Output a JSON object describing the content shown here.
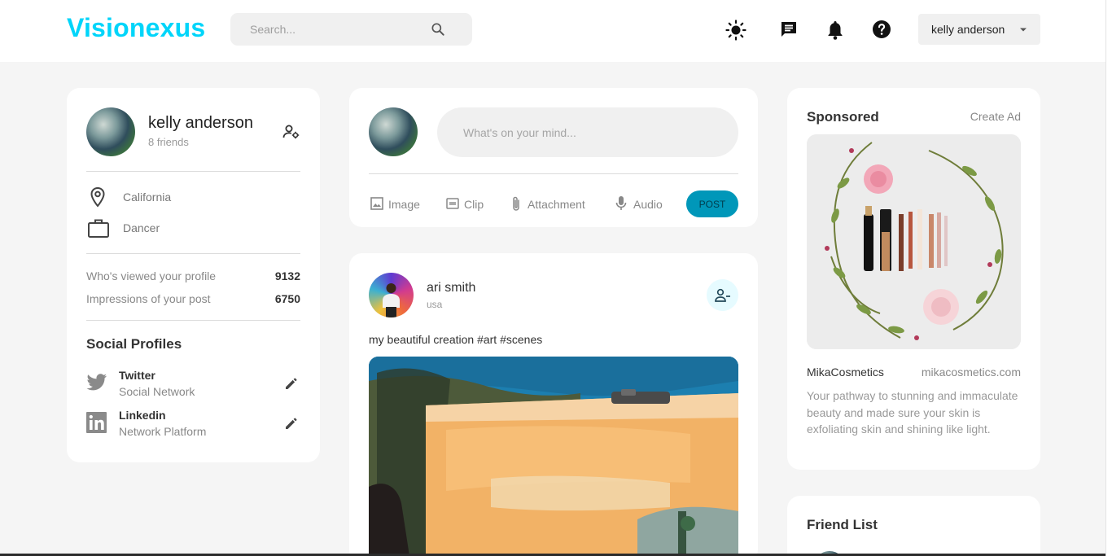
{
  "app": {
    "logo": "Visionexus",
    "search_placeholder": "Search...",
    "user_menu_label": "kelly anderson"
  },
  "icons": {
    "theme": "sun-icon",
    "messages": "chat-icon",
    "notifications": "bell-icon",
    "help": "help-icon",
    "caret": "caret-down-icon"
  },
  "profile": {
    "name": "kelly anderson",
    "friends": "8 friends",
    "location": "California",
    "occupation": "Dancer",
    "stats": [
      {
        "label": "Who's viewed your profile",
        "value": "9132"
      },
      {
        "label": "Impressions of your post",
        "value": "6750"
      }
    ],
    "social_title": "Social Profiles",
    "socials": [
      {
        "name": "Twitter",
        "sub": "Social Network"
      },
      {
        "name": "Linkedin",
        "sub": "Network Platform"
      }
    ]
  },
  "composer": {
    "placeholder": "What's on your mind...",
    "actions": [
      "Image",
      "Clip",
      "Attachment",
      "Audio"
    ],
    "post_label": "POST"
  },
  "post": {
    "author": "ari smith",
    "location": "usa",
    "text": "my beautiful creation #art #scenes"
  },
  "sponsored": {
    "title": "Sponsored",
    "create_ad": "Create Ad",
    "brand": "MikaCosmetics",
    "site": "mikacosmetics.com",
    "description": "Your pathway to stunning and immaculate beauty and made sure your skin is exfoliating skin and shining like light."
  },
  "friend_list": {
    "title": "Friend List"
  },
  "colors": {
    "brand": "#00d5fa",
    "post_button": "#0097b9",
    "background": "#f5f5f5",
    "card": "#ffffff"
  }
}
